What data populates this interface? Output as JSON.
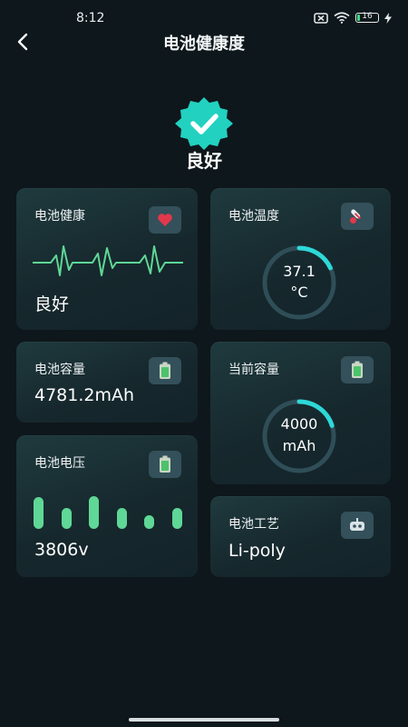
{
  "status_bar": {
    "time": "8:12",
    "battery_level": "16",
    "icons": [
      "sim-off-icon",
      "wifi-icon",
      "battery-icon",
      "charging-bolt-icon"
    ]
  },
  "header": {
    "title": "电池健康度",
    "back_icon": "chevron-left-icon"
  },
  "summary": {
    "badge_icon": "verified-check-badge-icon",
    "status": "良好"
  },
  "cards": {
    "health": {
      "title": "电池健康",
      "value": "良好",
      "icon": "heart-icon"
    },
    "temperature": {
      "title": "电池温度",
      "value_line1": "37.1",
      "value_line2": "°C",
      "icon": "thermometer-icon",
      "gauge_fraction": 0.18
    },
    "capacity": {
      "title": "电池容量",
      "value": "4781.2mAh",
      "icon": "battery-icon"
    },
    "current_capacity": {
      "title": "当前容量",
      "value_line1": "4000",
      "value_line2": "mAh",
      "icon": "battery-icon",
      "gauge_fraction": 0.2
    },
    "voltage": {
      "title": "电池电压",
      "value": "3806v",
      "icon": "battery-icon",
      "bar_levels": [
        0.78,
        0.5,
        0.8,
        0.5,
        0.33,
        0.5
      ]
    },
    "technology": {
      "title": "电池工艺",
      "value": "Li-poly",
      "icon": "robot-icon"
    }
  },
  "colors": {
    "background": "#0e171b",
    "accent_teal": "#2ed8d8",
    "bar_green": "#5fd796",
    "ecg_green": "#5fd796",
    "badge_teal": "#22d1c0"
  }
}
